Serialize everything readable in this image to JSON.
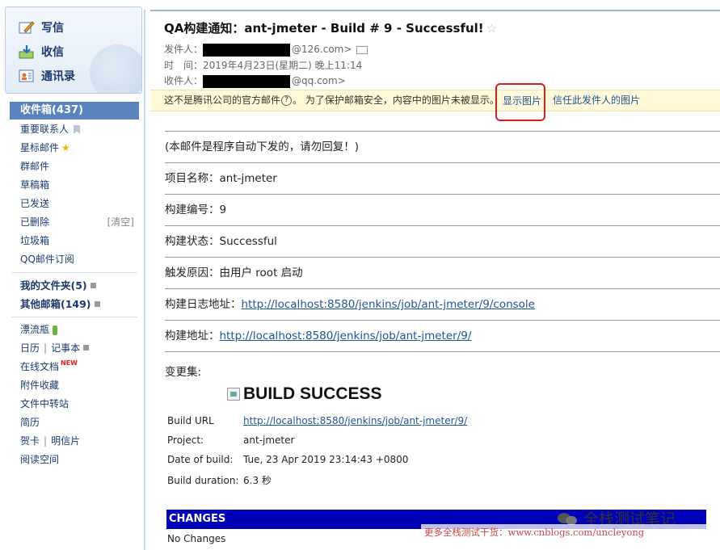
{
  "sidebar": {
    "actions": [
      {
        "label": "写信",
        "icon": "compose-icon"
      },
      {
        "label": "收信",
        "icon": "receive-icon"
      },
      {
        "label": "通讯录",
        "icon": "contacts-icon"
      }
    ],
    "inbox": "收件箱(437)",
    "folders": [
      {
        "label": "重要联系人",
        "icon": "bookmark-icon"
      },
      {
        "label": "星标邮件",
        "icon": "star-icon"
      },
      {
        "label": "群邮件"
      },
      {
        "label": "草稿箱"
      },
      {
        "label": "已发送"
      },
      {
        "label": "已删除",
        "aside": "[清空]"
      },
      {
        "label": "垃圾箱"
      },
      {
        "label": "QQ邮件订阅"
      }
    ],
    "my_folders": "我的文件夹(5)",
    "other_mailboxes": "其他邮箱(149)",
    "extras": {
      "drift_bottle": "漂流瓶",
      "calendar": "日历",
      "notepad": "记事本",
      "online_docs": "在线文档",
      "new_badge": "NEW",
      "attachments": "附件收藏",
      "file_transfer": "文件中转站",
      "resume": "简历",
      "greeting_card": "贺卡",
      "postcard": "明信片",
      "reading": "阅读空间",
      "pipe": "|"
    }
  },
  "mail": {
    "subject": "QA构建通知：ant-jmeter - Build # 9 - Successful!",
    "favorite_glyph": "☆",
    "from_label": "发件人：",
    "from_domain": "@126.com>",
    "time_label": "时　间：",
    "time_value": "2019年4月23日(星期二) 晚上11:14",
    "to_label": "收件人：",
    "to_domain": "@qq.com>",
    "warning": {
      "text": "这不是腾讯公司的官方邮件",
      "help": "?",
      "text2": "。 为了保护邮箱安全，内容中的图片未被显示。",
      "show_images": "显示图片",
      "trust_sender": "信任此发件人的图片"
    },
    "body": {
      "notice": "(本邮件是程序自动下发的，请勿回复！)",
      "project_label": "项目名称：",
      "project_value": "ant-jmeter",
      "build_no_label": "构建编号：",
      "build_no_value": "9",
      "status_label": "构建状态：",
      "status_value": "Successful",
      "cause_label": "触发原因：",
      "cause_value": "由用户 root 启动",
      "log_label": "构建日志地址：",
      "log_url": "http://localhost:8580/jenkins/job/ant-jmeter/9/console",
      "build_url_label": "构建地址：",
      "build_url": "http://localhost:8580/jenkins/job/ant-jmeter/9/",
      "changes_label": "变更集:"
    },
    "report": {
      "title": "BUILD SUCCESS",
      "rows": [
        {
          "key": "Build URL",
          "value": "http://localhost:8580/jenkins/job/ant-jmeter/9/",
          "link": true
        },
        {
          "key": "Project:",
          "value": "ant-jmeter"
        },
        {
          "key": "Date of build:",
          "value": "Tue, 23 Apr 2019 23:14:43 +0800"
        },
        {
          "key": "Build duration:",
          "value": "6.3 秒"
        }
      ],
      "changes_header": "CHANGES",
      "no_changes": "No Changes"
    }
  },
  "watermark": {
    "brand": "全栈测试笔记",
    "line": "更多全栈测试干货：www.cnblogs.com/uncleyong"
  },
  "colors": {
    "inbox_bg": "#5a83bd",
    "link": "#1e5494",
    "warning_bg": "#fff8d9",
    "highlight_box": "#d62020",
    "changes_bar": "#0000b8"
  }
}
